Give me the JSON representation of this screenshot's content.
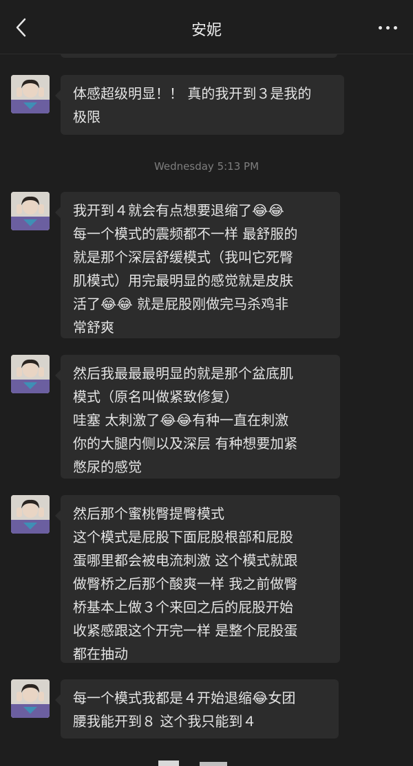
{
  "header": {
    "title": "安妮",
    "back_icon": "chevron-left-icon",
    "more_icon": "more-dots-icon"
  },
  "timestamp": "Wednesday 5:13 PM",
  "messages": [
    {
      "text": "体感超级明显！！ 真的我开到３是我的\n极限"
    },
    {
      "text": "我开到４就会有点想要退缩了😂😂\n每一个模式的震频都不一样 最舒服的\n就是那个深层舒缓模式（我叫它死臀\n肌模式）用完最明显的感觉就是皮肤\n活了😂😂 就是屁股刚做完马杀鸡非\n常舒爽"
    },
    {
      "text": "然后我最最最明显的就是那个盆底肌\n模式（原名叫做紧致修复）\n哇塞 太刺激了😂😂有种一直在刺激\n你的大腿内侧以及深层 有种想要加紧\n憋尿的感觉"
    },
    {
      "text": "然后那个蜜桃臀提臀模式\n这个模式是屁股下面屁股根部和屁股\n蛋哪里都会被电流刺激 这个模式就跟\n做臀桥之后那个酸爽一样 我之前做臀\n桥基本上做３个来回之后的屁股开始\n收紧感跟这个开完一样 是整个屁股蛋\n都在抽动"
    },
    {
      "text": "每一个模式我都是４开始退缩😂女团\n腰我能开到８ 这个我只能到４"
    }
  ],
  "colors": {
    "background": "#1e1e1e",
    "bubble": "#2c2c2c",
    "text": "#e4e4e4",
    "timestamp": "#7e7e7e"
  }
}
